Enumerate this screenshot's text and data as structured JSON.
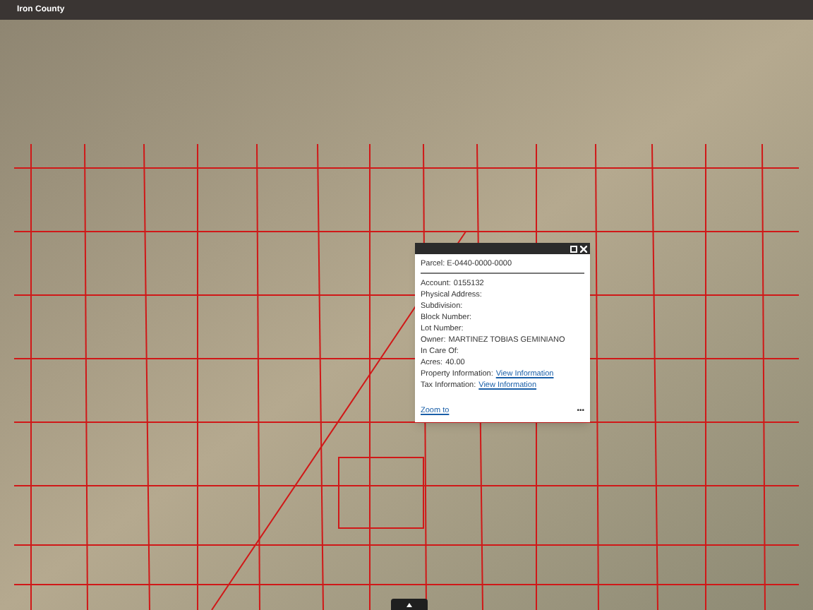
{
  "header": {
    "title": "Iron County"
  },
  "popup": {
    "title": "Parcel: E-0440-0000-0000",
    "fields": [
      {
        "label": "Account:",
        "value": "0155132"
      },
      {
        "label": "Physical Address:"
      },
      {
        "label": "Subdivision:"
      },
      {
        "label": "Block Number:"
      },
      {
        "label": "Lot Number:"
      },
      {
        "label": "Owner:",
        "value": "MARTINEZ TOBIAS GEMINIANO"
      },
      {
        "label": "In Care Of:"
      },
      {
        "label": "Acres:",
        "value": "40.00"
      },
      {
        "label": "Property Information:",
        "link": "View Information"
      },
      {
        "label": "Tax Information:",
        "link": "View Information"
      }
    ],
    "zoom_link": "Zoom to",
    "menu": "•••"
  }
}
